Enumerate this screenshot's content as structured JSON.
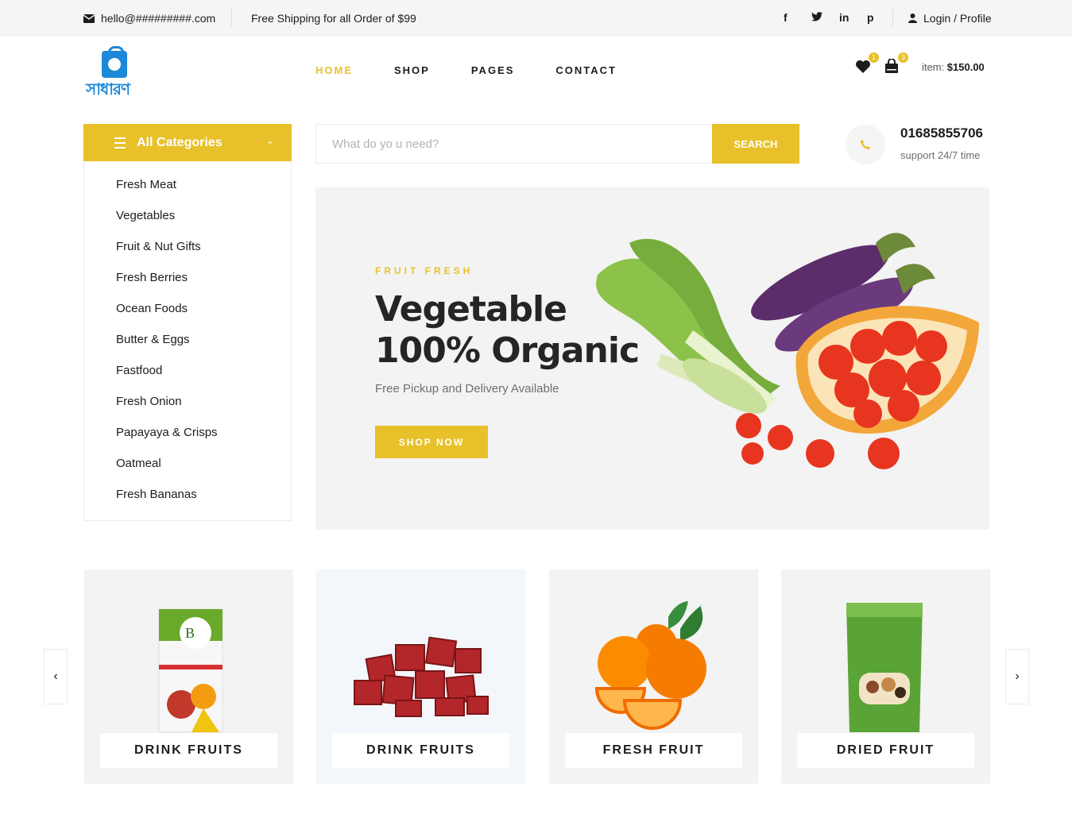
{
  "topbar": {
    "email": "hello@#########.com",
    "shipping": "Free Shipping for all Order of $99",
    "social": [
      "f",
      "t",
      "in",
      "p"
    ],
    "login": "Login / Profile"
  },
  "logo": {
    "text": "সাধারণ"
  },
  "nav": {
    "items": [
      "HOME",
      "SHOP",
      "PAGES",
      "CONTACT"
    ],
    "active": "HOME"
  },
  "header": {
    "wishlist_count": "1",
    "cart_count": "3",
    "item_label": "item:",
    "item_total": "$150.00"
  },
  "categories": {
    "title": "All Categories",
    "items": [
      "Fresh Meat",
      "Vegetables",
      "Fruit & Nut Gifts",
      "Fresh Berries",
      "Ocean Foods",
      "Butter & Eggs",
      "Fastfood",
      "Fresh Onion",
      "Papayaya & Crisps",
      "Oatmeal",
      "Fresh Bananas"
    ]
  },
  "search": {
    "placeholder": "What do yo u need?",
    "button": "SEARCH"
  },
  "support": {
    "phone": "01685855706",
    "text": "support 24/7 time"
  },
  "hero": {
    "kicker": "FRUIT FRESH",
    "title_line1": "Vegetable",
    "title_line2": "100% Organic",
    "subtitle": "Free Pickup and Delivery Available",
    "button": "SHOP NOW"
  },
  "carousel": {
    "cards": [
      "DRINK FRUITS",
      "DRINK FRUITS",
      "FRESH FRUIT",
      "DRIED FRUIT"
    ]
  },
  "colors": {
    "accent": "#e8c12a",
    "logo_blue": "#1e88d8",
    "text": "#1c1c1c"
  }
}
